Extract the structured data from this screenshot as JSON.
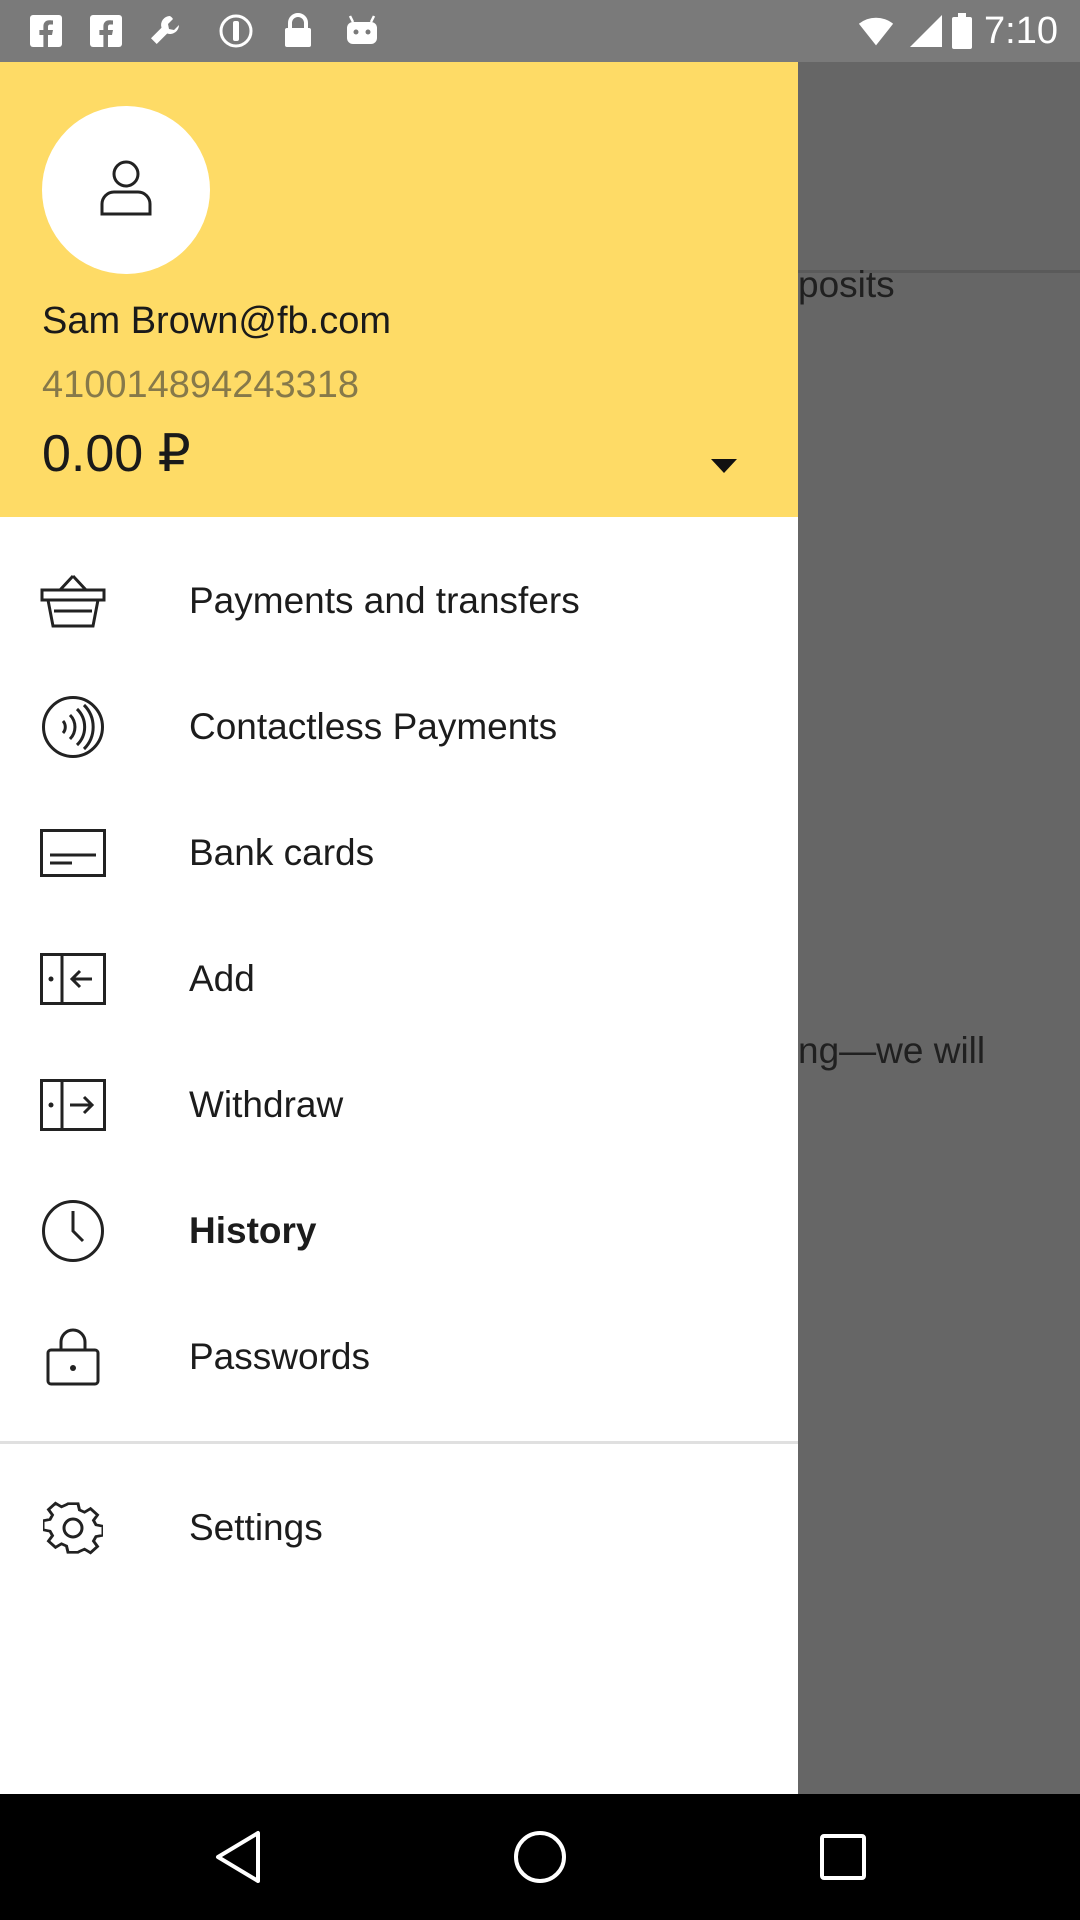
{
  "status_bar": {
    "time": "7:10",
    "icons": [
      "facebook-icon",
      "facebook-icon",
      "wrench-icon",
      "info-circle-icon",
      "lock-icon",
      "android-icon",
      "wifi-icon",
      "signal-icon",
      "battery-icon"
    ]
  },
  "background": {
    "partial_text_1": "posits",
    "partial_text_2": "ng—we will"
  },
  "drawer": {
    "header": {
      "email": "Sam Brown@fb.com",
      "account_number": "410014894243318",
      "balance": "0.00 ₽",
      "background_color": "#fedb66"
    },
    "items": [
      {
        "label": "Payments and transfers",
        "icon": "basket-icon"
      },
      {
        "label": "Contactless Payments",
        "icon": "contactless-icon"
      },
      {
        "label": "Bank cards",
        "icon": "bank-card-icon"
      },
      {
        "label": "Add",
        "icon": "wallet-add-icon"
      },
      {
        "label": "Withdraw",
        "icon": "wallet-withdraw-icon"
      },
      {
        "label": "History",
        "icon": "clock-icon",
        "active": true
      },
      {
        "label": "Passwords",
        "icon": "lock-icon"
      },
      {
        "label": "Settings",
        "icon": "gear-icon"
      }
    ]
  },
  "nav_bar": {
    "buttons": [
      "back-icon",
      "home-icon",
      "recents-icon"
    ]
  }
}
